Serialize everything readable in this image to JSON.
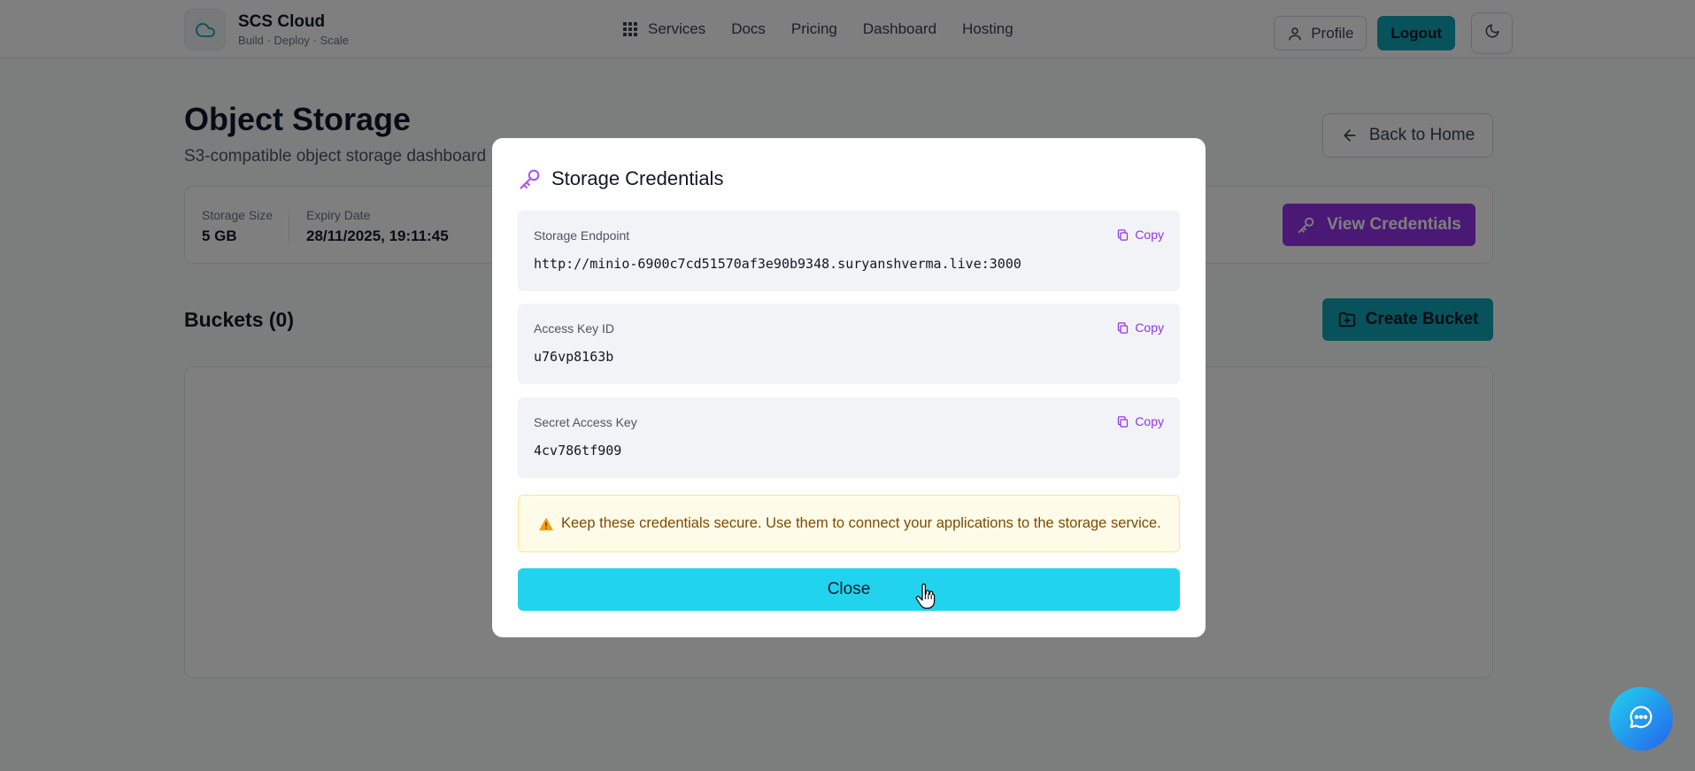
{
  "header": {
    "brand_name": "SCS Cloud",
    "brand_tagline": "Build · Deploy · Scale",
    "nav": [
      {
        "label": "Services",
        "icon": "grid-icon"
      },
      {
        "label": "Docs"
      },
      {
        "label": "Pricing"
      },
      {
        "label": "Dashboard"
      },
      {
        "label": "Hosting"
      }
    ],
    "profile_label": "Profile",
    "logout_label": "Logout"
  },
  "page": {
    "title": "Object Storage",
    "subtitle": "S3-compatible object storage dashboard",
    "back_label": "Back to Home",
    "stats": [
      {
        "label": "Storage Size",
        "value": "5 GB"
      },
      {
        "label": "Expiry Date",
        "value": "28/11/2025, 19:11:45"
      }
    ],
    "view_credentials_label": "View Credentials",
    "buckets_title": "Buckets (0)",
    "create_bucket_label": "Create Bucket"
  },
  "modal": {
    "title": "Storage Credentials",
    "copy_label": "Copy",
    "credentials": [
      {
        "label": "Storage Endpoint",
        "value": "http://minio-6900c7cd51570af3e90b9348.suryanshverma.live:3000"
      },
      {
        "label": "Access Key ID",
        "value": "u76vp8163b"
      },
      {
        "label": "Secret Access Key",
        "value": "4cv786tf909"
      }
    ],
    "warning": "Keep these credentials secure. Use them to connect your applications to the storage service.",
    "close_label": "Close"
  },
  "colors": {
    "accent_cyan": "#22d3ee",
    "accent_teal": "#0ea5b7",
    "accent_purple": "#9333ea",
    "warning_bg": "#fefce8"
  },
  "icons": [
    "cloud-icon",
    "grid-icon",
    "user-icon",
    "moon-icon",
    "arrow-left-icon",
    "key-icon",
    "folder-plus-icon",
    "copy-icon",
    "warning-icon",
    "chat-icon",
    "hand-cursor-icon"
  ]
}
